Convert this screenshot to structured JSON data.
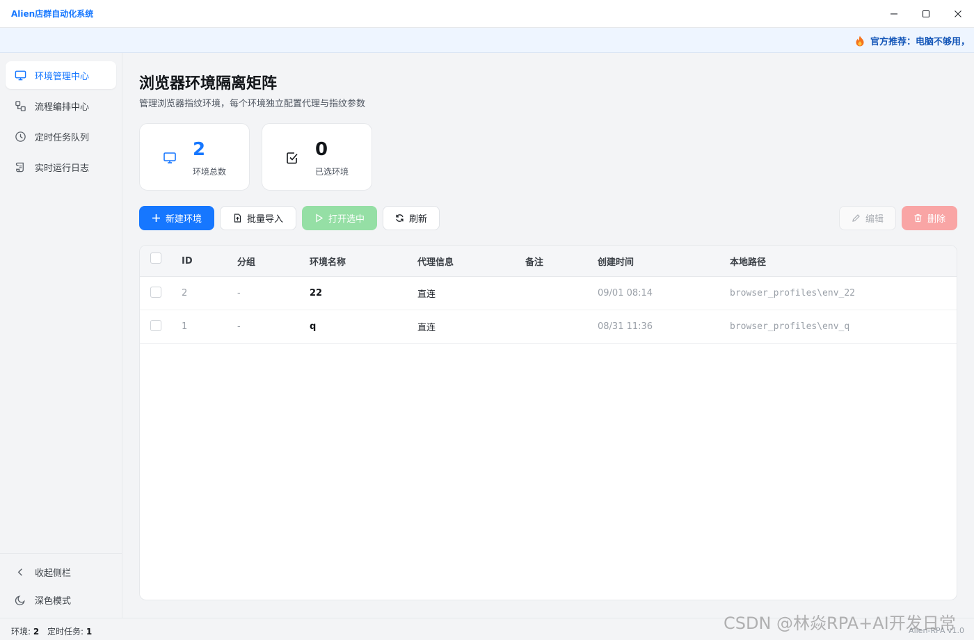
{
  "window": {
    "title": "Alien店群自动化系统"
  },
  "banner": {
    "text": "官方推荐：电脑不够用，"
  },
  "sidebar": {
    "items": [
      {
        "label": "环境管理中心",
        "icon": "monitor-icon",
        "active": true
      },
      {
        "label": "流程编排中心",
        "icon": "flow-icon",
        "active": false
      },
      {
        "label": "定时任务队列",
        "icon": "clock-icon",
        "active": false
      },
      {
        "label": "实时运行日志",
        "icon": "scroll-icon",
        "active": false
      }
    ],
    "collapse_label": "收起侧栏",
    "dark_mode_label": "深色模式"
  },
  "header": {
    "title": "浏览器环境隔离矩阵",
    "subtitle": "管理浏览器指纹环境，每个环境独立配置代理与指纹参数"
  },
  "stats": [
    {
      "value": "2",
      "label": "环境总数",
      "icon": "monitor-icon",
      "color": "#1677ff"
    },
    {
      "value": "0",
      "label": "已选环境",
      "icon": "checkbox-icon",
      "color": "#111418"
    }
  ],
  "toolbar": {
    "new_label": "新建环境",
    "import_label": "批量导入",
    "open_label": "打开选中",
    "refresh_label": "刷新",
    "edit_label": "编辑",
    "delete_label": "删除"
  },
  "table": {
    "columns": [
      "ID",
      "分组",
      "环境名称",
      "代理信息",
      "备注",
      "创建时间",
      "本地路径"
    ],
    "rows": [
      {
        "id": "2",
        "group": "-",
        "name": "22",
        "proxy": "直连",
        "note": "",
        "created": "09/01 08:14",
        "path": "browser_profiles\\env_22"
      },
      {
        "id": "1",
        "group": "-",
        "name": "q",
        "proxy": "直连",
        "note": "",
        "created": "08/31 11:36",
        "path": "browser_profiles\\env_q"
      }
    ]
  },
  "status": {
    "env_label": "环境:",
    "env_value": "2",
    "task_label": "定时任务:",
    "task_value": "1",
    "version": "Alien-RPA v1.0"
  },
  "watermark": "CSDN @林焱RPA+AI开发日常",
  "colors": {
    "accent": "#1677ff",
    "success_disabled": "#95dfa5",
    "danger_disabled": "#f9a5a5"
  }
}
